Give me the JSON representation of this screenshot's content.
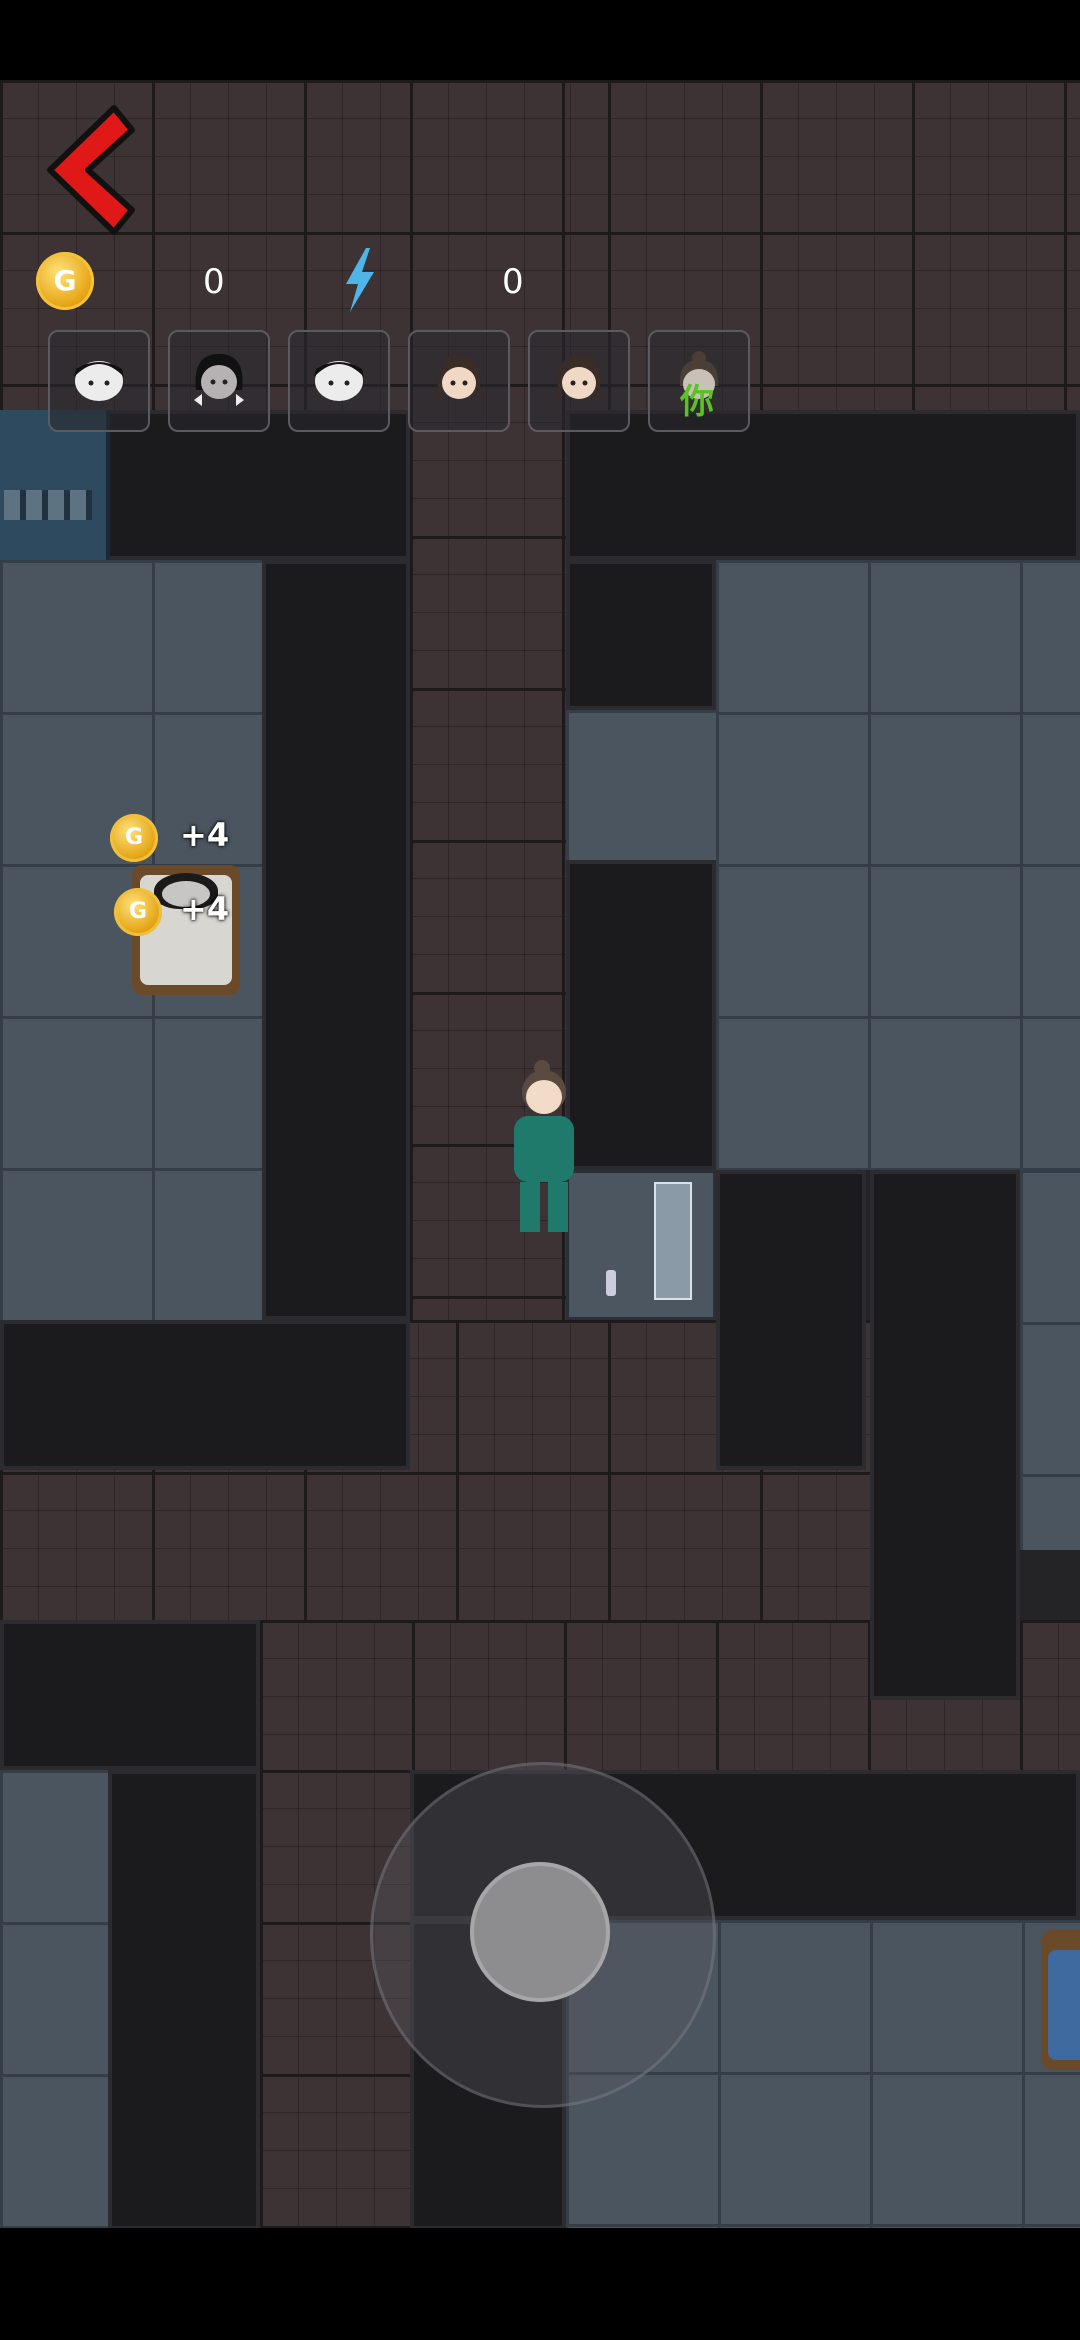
{
  "hud": {
    "back_icon": "red-chevron-left-icon",
    "coin_icon_letter": "G",
    "coin_count": "0",
    "energy_icon": "lightning-bolt-icon",
    "energy_count": "0"
  },
  "players": [
    {
      "portrait": "boy-portrait-icon",
      "label": ""
    },
    {
      "portrait": "girl-bows-portrait-icon",
      "label": ""
    },
    {
      "portrait": "boy-portrait-icon",
      "label": ""
    },
    {
      "portrait": "girl-pigtails-portrait-icon",
      "label": ""
    },
    {
      "portrait": "girl-pigtails-portrait-icon",
      "label": ""
    },
    {
      "portrait": "ponytail-girl-portrait-icon",
      "label": "你"
    }
  ],
  "floating_rewards": [
    {
      "coin_letter": "G",
      "text": "+4"
    },
    {
      "coin_letter": "G",
      "text": "+4"
    }
  ],
  "colors": {
    "back_arrow": "#e01818",
    "coin": "#f2b526",
    "energy": "#4fb4e6",
    "you_label": "#58c322",
    "player_outfit": "#1f7a6b"
  }
}
